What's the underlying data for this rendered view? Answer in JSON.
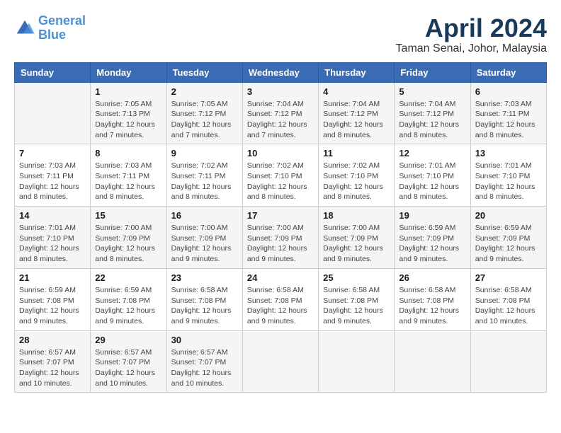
{
  "logo": {
    "line1": "General",
    "line2": "Blue"
  },
  "title": "April 2024",
  "subtitle": "Taman Senai, Johor, Malaysia",
  "days_header": [
    "Sunday",
    "Monday",
    "Tuesday",
    "Wednesday",
    "Thursday",
    "Friday",
    "Saturday"
  ],
  "weeks": [
    [
      {
        "day": "",
        "info": ""
      },
      {
        "day": "1",
        "info": "Sunrise: 7:05 AM\nSunset: 7:13 PM\nDaylight: 12 hours\nand 7 minutes."
      },
      {
        "day": "2",
        "info": "Sunrise: 7:05 AM\nSunset: 7:12 PM\nDaylight: 12 hours\nand 7 minutes."
      },
      {
        "day": "3",
        "info": "Sunrise: 7:04 AM\nSunset: 7:12 PM\nDaylight: 12 hours\nand 7 minutes."
      },
      {
        "day": "4",
        "info": "Sunrise: 7:04 AM\nSunset: 7:12 PM\nDaylight: 12 hours\nand 8 minutes."
      },
      {
        "day": "5",
        "info": "Sunrise: 7:04 AM\nSunset: 7:12 PM\nDaylight: 12 hours\nand 8 minutes."
      },
      {
        "day": "6",
        "info": "Sunrise: 7:03 AM\nSunset: 7:11 PM\nDaylight: 12 hours\nand 8 minutes."
      }
    ],
    [
      {
        "day": "7",
        "info": "Sunrise: 7:03 AM\nSunset: 7:11 PM\nDaylight: 12 hours\nand 8 minutes."
      },
      {
        "day": "8",
        "info": "Sunrise: 7:03 AM\nSunset: 7:11 PM\nDaylight: 12 hours\nand 8 minutes."
      },
      {
        "day": "9",
        "info": "Sunrise: 7:02 AM\nSunset: 7:11 PM\nDaylight: 12 hours\nand 8 minutes."
      },
      {
        "day": "10",
        "info": "Sunrise: 7:02 AM\nSunset: 7:10 PM\nDaylight: 12 hours\nand 8 minutes."
      },
      {
        "day": "11",
        "info": "Sunrise: 7:02 AM\nSunset: 7:10 PM\nDaylight: 12 hours\nand 8 minutes."
      },
      {
        "day": "12",
        "info": "Sunrise: 7:01 AM\nSunset: 7:10 PM\nDaylight: 12 hours\nand 8 minutes."
      },
      {
        "day": "13",
        "info": "Sunrise: 7:01 AM\nSunset: 7:10 PM\nDaylight: 12 hours\nand 8 minutes."
      }
    ],
    [
      {
        "day": "14",
        "info": "Sunrise: 7:01 AM\nSunset: 7:10 PM\nDaylight: 12 hours\nand 8 minutes."
      },
      {
        "day": "15",
        "info": "Sunrise: 7:00 AM\nSunset: 7:09 PM\nDaylight: 12 hours\nand 8 minutes."
      },
      {
        "day": "16",
        "info": "Sunrise: 7:00 AM\nSunset: 7:09 PM\nDaylight: 12 hours\nand 9 minutes."
      },
      {
        "day": "17",
        "info": "Sunrise: 7:00 AM\nSunset: 7:09 PM\nDaylight: 12 hours\nand 9 minutes."
      },
      {
        "day": "18",
        "info": "Sunrise: 7:00 AM\nSunset: 7:09 PM\nDaylight: 12 hours\nand 9 minutes."
      },
      {
        "day": "19",
        "info": "Sunrise: 6:59 AM\nSunset: 7:09 PM\nDaylight: 12 hours\nand 9 minutes."
      },
      {
        "day": "20",
        "info": "Sunrise: 6:59 AM\nSunset: 7:09 PM\nDaylight: 12 hours\nand 9 minutes."
      }
    ],
    [
      {
        "day": "21",
        "info": "Sunrise: 6:59 AM\nSunset: 7:08 PM\nDaylight: 12 hours\nand 9 minutes."
      },
      {
        "day": "22",
        "info": "Sunrise: 6:59 AM\nSunset: 7:08 PM\nDaylight: 12 hours\nand 9 minutes."
      },
      {
        "day": "23",
        "info": "Sunrise: 6:58 AM\nSunset: 7:08 PM\nDaylight: 12 hours\nand 9 minutes."
      },
      {
        "day": "24",
        "info": "Sunrise: 6:58 AM\nSunset: 7:08 PM\nDaylight: 12 hours\nand 9 minutes."
      },
      {
        "day": "25",
        "info": "Sunrise: 6:58 AM\nSunset: 7:08 PM\nDaylight: 12 hours\nand 9 minutes."
      },
      {
        "day": "26",
        "info": "Sunrise: 6:58 AM\nSunset: 7:08 PM\nDaylight: 12 hours\nand 9 minutes."
      },
      {
        "day": "27",
        "info": "Sunrise: 6:58 AM\nSunset: 7:08 PM\nDaylight: 12 hours\nand 10 minutes."
      }
    ],
    [
      {
        "day": "28",
        "info": "Sunrise: 6:57 AM\nSunset: 7:07 PM\nDaylight: 12 hours\nand 10 minutes."
      },
      {
        "day": "29",
        "info": "Sunrise: 6:57 AM\nSunset: 7:07 PM\nDaylight: 12 hours\nand 10 minutes."
      },
      {
        "day": "30",
        "info": "Sunrise: 6:57 AM\nSunset: 7:07 PM\nDaylight: 12 hours\nand 10 minutes."
      },
      {
        "day": "",
        "info": ""
      },
      {
        "day": "",
        "info": ""
      },
      {
        "day": "",
        "info": ""
      },
      {
        "day": "",
        "info": ""
      }
    ]
  ]
}
